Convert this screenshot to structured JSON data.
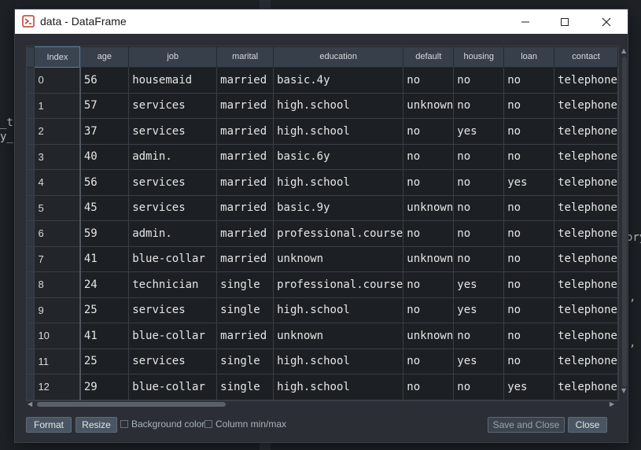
{
  "background": {
    "fragments": [
      "_tr",
      "y_s",
      "ory",
      ",",
      ","
    ]
  },
  "window": {
    "title": "data - DataFrame",
    "icons": {
      "app": "dataframe-app-icon",
      "minimize": "minimize-icon",
      "maximize": "maximize-icon",
      "close": "close-icon"
    }
  },
  "table": {
    "columns": [
      "Index",
      "age",
      "job",
      "marital",
      "education",
      "default",
      "housing",
      "loan",
      "contact"
    ],
    "rows": [
      [
        "0",
        "56",
        "housemaid",
        "married",
        "basic.4y",
        "no",
        "no",
        "no",
        "telephone"
      ],
      [
        "1",
        "57",
        "services",
        "married",
        "high.school",
        "unknown",
        "no",
        "no",
        "telephone"
      ],
      [
        "2",
        "37",
        "services",
        "married",
        "high.school",
        "no",
        "yes",
        "no",
        "telephone"
      ],
      [
        "3",
        "40",
        "admin.",
        "married",
        "basic.6y",
        "no",
        "no",
        "no",
        "telephone"
      ],
      [
        "4",
        "56",
        "services",
        "married",
        "high.school",
        "no",
        "no",
        "yes",
        "telephone"
      ],
      [
        "5",
        "45",
        "services",
        "married",
        "basic.9y",
        "unknown",
        "no",
        "no",
        "telephone"
      ],
      [
        "6",
        "59",
        "admin.",
        "married",
        "professional.course",
        "no",
        "no",
        "no",
        "telephone"
      ],
      [
        "7",
        "41",
        "blue-collar",
        "married",
        "unknown",
        "unknown",
        "no",
        "no",
        "telephone"
      ],
      [
        "8",
        "24",
        "technician",
        "single",
        "professional.course",
        "no",
        "yes",
        "no",
        "telephone"
      ],
      [
        "9",
        "25",
        "services",
        "single",
        "high.school",
        "no",
        "yes",
        "no",
        "telephone"
      ],
      [
        "10",
        "41",
        "blue-collar",
        "married",
        "unknown",
        "unknown",
        "no",
        "no",
        "telephone"
      ],
      [
        "11",
        "25",
        "services",
        "single",
        "high.school",
        "no",
        "yes",
        "no",
        "telephone"
      ],
      [
        "12",
        "29",
        "blue-collar",
        "single",
        "high.school",
        "no",
        "no",
        "yes",
        "telephone"
      ]
    ]
  },
  "footer": {
    "format_label": "Format",
    "resize_label": "Resize",
    "background_color_label": "Background color",
    "column_minmax_label": "Column min/max",
    "save_close_label": "Save and Close",
    "close_label": "Close"
  }
}
